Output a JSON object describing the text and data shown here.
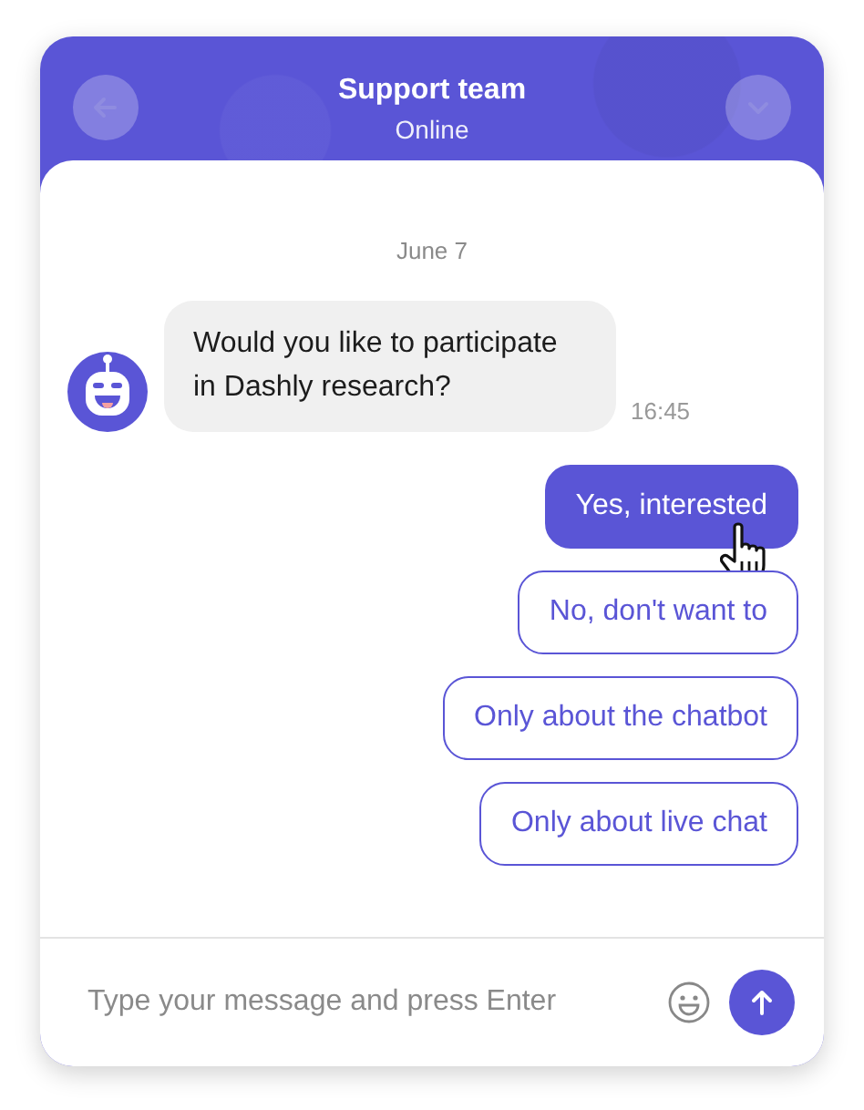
{
  "header": {
    "title": "Support team",
    "status": "Online"
  },
  "date": "June 7",
  "message": {
    "text": "Would you like to participate in Dashly research?",
    "time": "16:45"
  },
  "options": [
    {
      "label": "Yes, interested",
      "selected": true
    },
    {
      "label": "No, don't want to",
      "selected": false
    },
    {
      "label": "Only about the chatbot",
      "selected": false
    },
    {
      "label": "Only about live chat",
      "selected": false
    }
  ],
  "composer": {
    "placeholder": "Type your message and press Enter"
  }
}
